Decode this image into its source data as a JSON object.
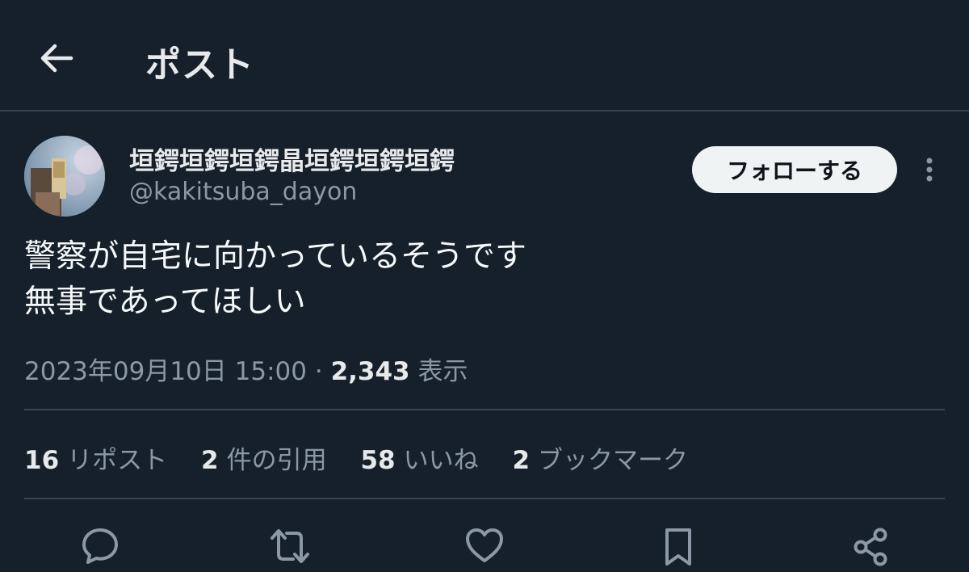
{
  "header": {
    "title": "ポスト"
  },
  "author": {
    "display_name": "垣鍔垣鍔垣鍔晶垣鍔垣鍔垣鍔",
    "handle": "@kakitsuba_dayon",
    "follow_label": "フォローする"
  },
  "tweet": {
    "lines": [
      "警察が自宅に向かっているそうです",
      "無事であってほしい"
    ],
    "timestamp": "2023年09月10日 15:00",
    "separator": "·",
    "views_count": "2,343",
    "views_label": "表示"
  },
  "stats": {
    "reposts_count": "16",
    "reposts_label": "リポスト",
    "quotes_count": "2",
    "quotes_label": "件の引用",
    "likes_count": "58",
    "likes_label": "いいね",
    "bookmarks_count": "2",
    "bookmarks_label": "ブックマーク"
  },
  "icons": [
    "arrow-left-icon",
    "more-vertical-icon",
    "reply-icon",
    "repost-icon",
    "like-icon",
    "bookmark-icon",
    "share-icon"
  ],
  "colors": {
    "background": "#15202b",
    "text": "#e7e9ea",
    "secondary_text": "#8b98a5",
    "divider": "#38444d",
    "button_bg": "#eff3f4"
  }
}
